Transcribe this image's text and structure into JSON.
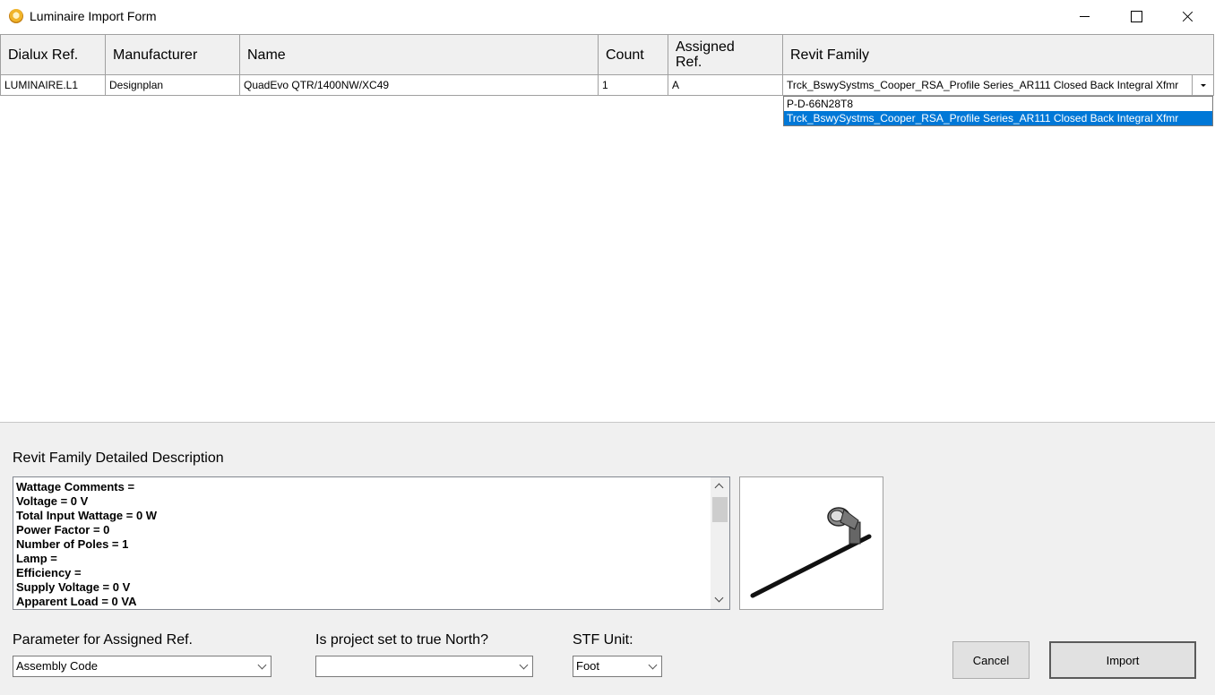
{
  "window": {
    "title": "Luminaire Import Form"
  },
  "grid": {
    "columns": [
      "Dialux Ref.",
      "Manufacturer",
      "Name",
      "Count",
      "Assigned Ref.",
      "Revit Family"
    ],
    "rows": [
      {
        "dialux_ref": "LUMINAIRE.L1",
        "manufacturer": "Designplan",
        "name": "QuadEvo QTR/1400NW/XC49",
        "count": "1",
        "assigned_ref": "A",
        "revit_family": "Trck_BswySystms_Cooper_RSA_Profile Series_AR111 Closed Back Integral Xfmr"
      }
    ],
    "revit_family_options": [
      "P-D-66N28T8",
      "Trck_BswySystms_Cooper_RSA_Profile Series_AR111 Closed Back Integral Xfmr"
    ],
    "selected_option_index": 1
  },
  "description": {
    "label": "Revit Family Detailed Description",
    "lines": [
      "Wattage Comments =",
      "Voltage = 0 V",
      "Total Input Wattage = 0 W",
      "Power Factor = 0",
      "Number of Poles = 1",
      "Lamp =",
      "Efficiency =",
      "Supply Voltage = 0 V",
      "Apparent Load = 0 VA"
    ]
  },
  "params": {
    "assigned_ref_label": "Parameter for Assigned Ref.",
    "assigned_ref_value": "Assembly Code",
    "true_north_label": "Is project set to true North?",
    "true_north_value": "",
    "stf_unit_label": "STF Unit:",
    "stf_unit_value": "Foot"
  },
  "buttons": {
    "cancel": "Cancel",
    "import": "Import"
  }
}
